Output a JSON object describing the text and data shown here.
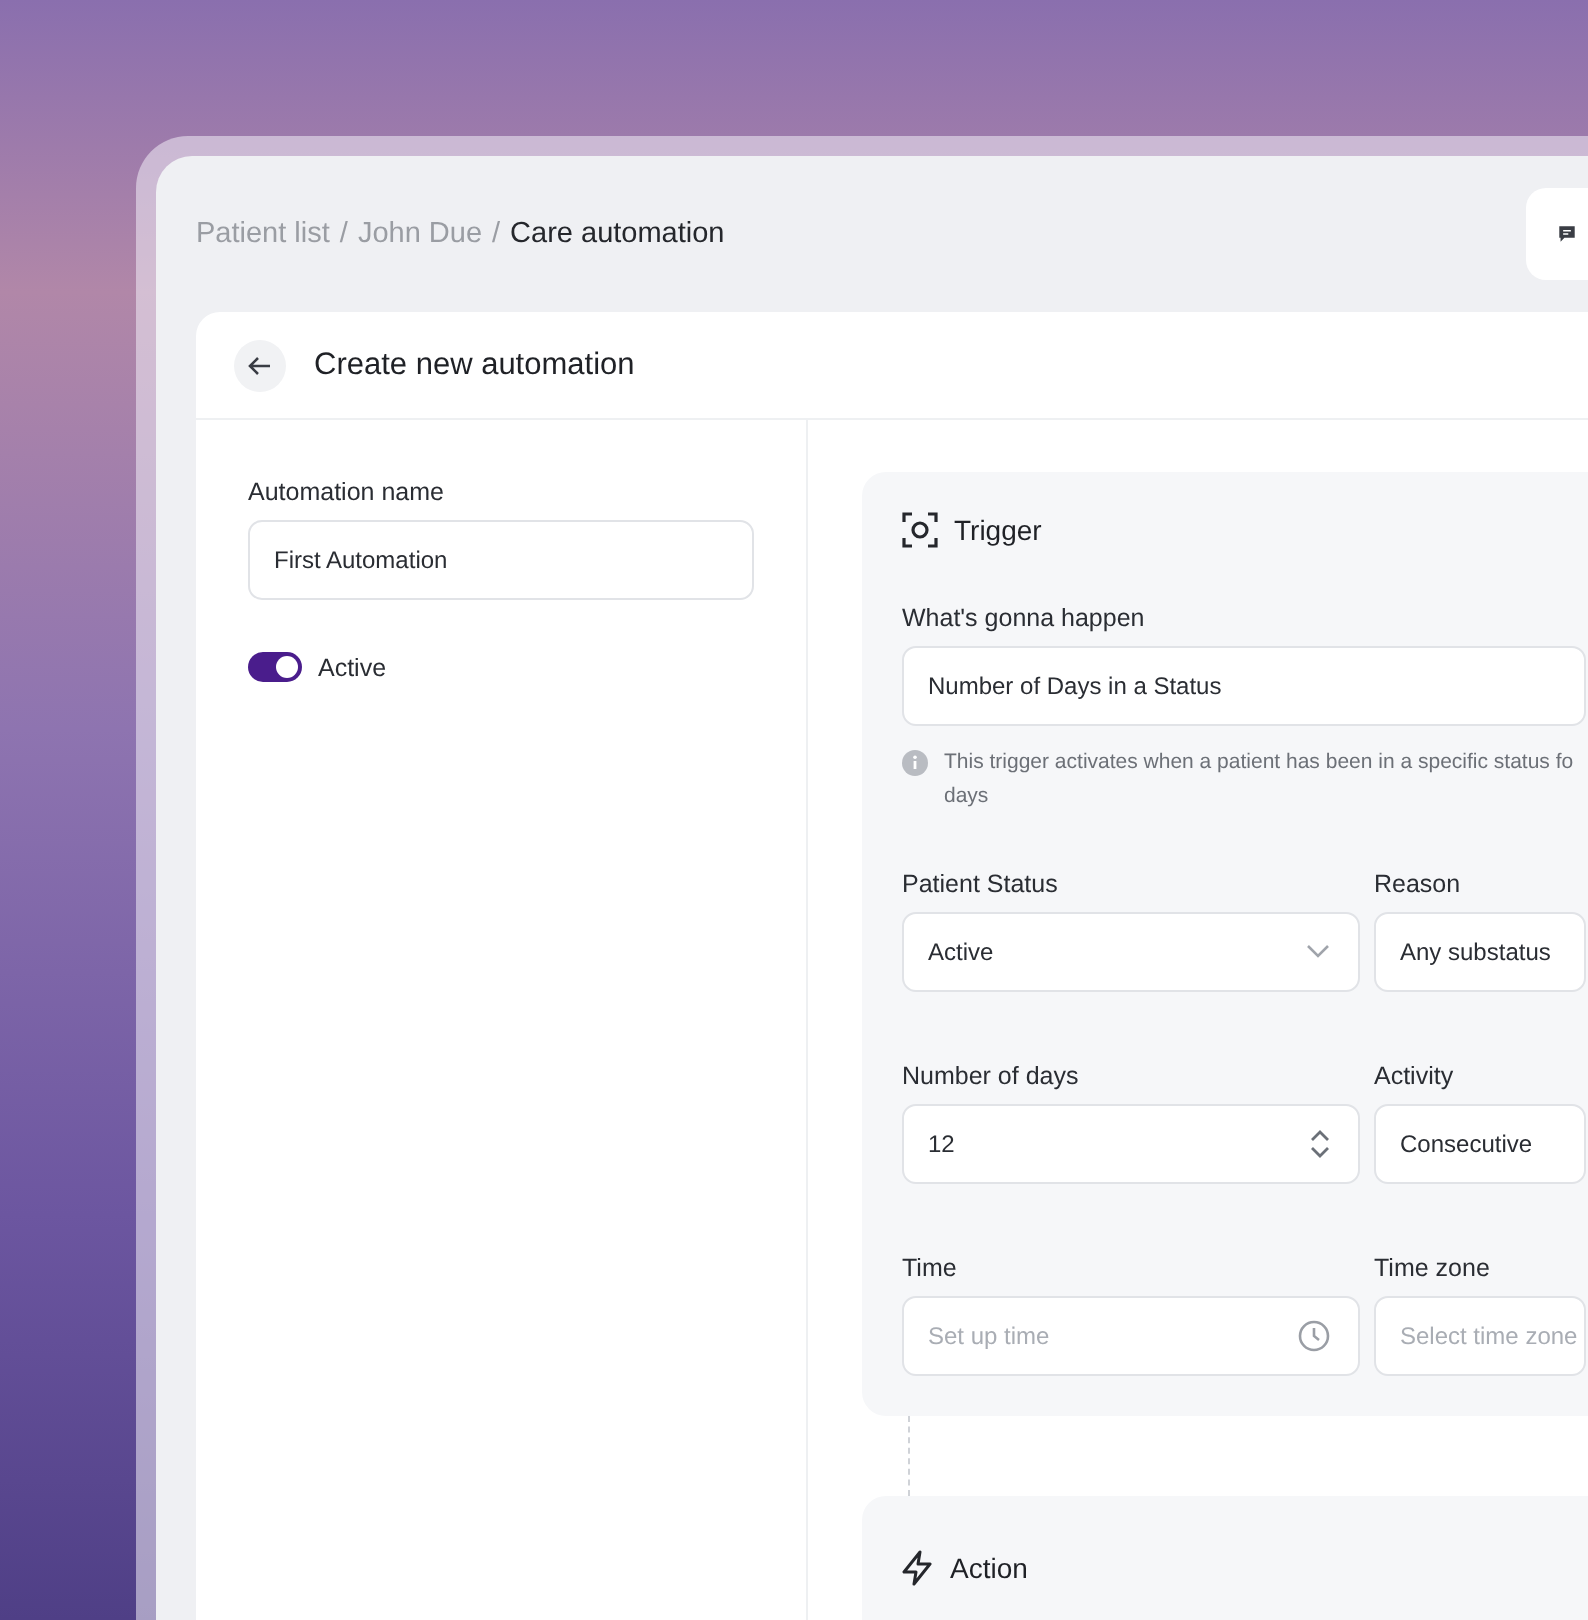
{
  "breadcrumb": {
    "separator": "/",
    "items": [
      {
        "label": "Patient list",
        "current": false
      },
      {
        "label": "John Due",
        "current": false
      },
      {
        "label": "Care automation",
        "current": true
      }
    ]
  },
  "page_title": "Create new automation",
  "automation_name": {
    "label": "Automation name",
    "value": "First Automation"
  },
  "active_toggle": {
    "label": "Active",
    "on": true
  },
  "trigger": {
    "title": "Trigger",
    "what": {
      "label": "What's gonna happen",
      "value": "Number of Days in a Status"
    },
    "help_lines": [
      "This trigger activates when a patient has been in a specific status fo",
      "days"
    ],
    "fields": [
      {
        "label": "Patient Status",
        "value": "Active",
        "kind": "select"
      },
      {
        "label": "Reason",
        "value": "Any substatus",
        "kind": "plain"
      },
      {
        "label": "Number of days",
        "value": "12",
        "kind": "stepper"
      },
      {
        "label": "Activity",
        "value": "Consecutive",
        "kind": "plain"
      },
      {
        "label": "Time",
        "placeholder": "Set up time",
        "kind": "time"
      },
      {
        "label": "Time zone",
        "placeholder": "Select time zone",
        "kind": "plain"
      }
    ]
  },
  "action": {
    "title": "Action"
  }
}
